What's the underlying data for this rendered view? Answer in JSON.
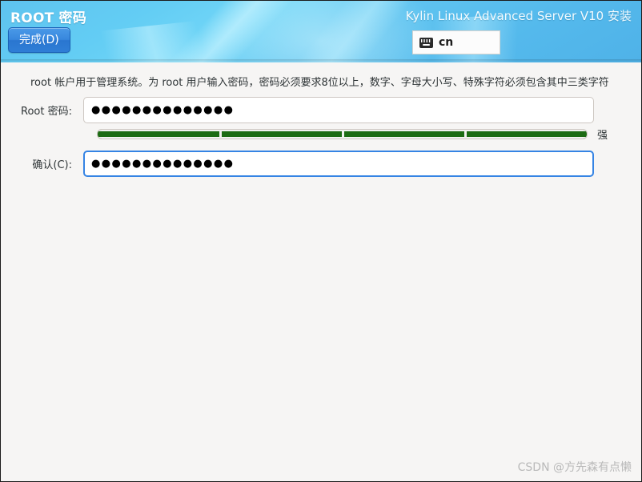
{
  "header": {
    "spoke_title": "ROOT 密码",
    "product_title": "Kylin Linux Advanced Server V10 安装",
    "done_button_label": "完成(D)",
    "keyboard_layout": "cn",
    "keyboard_icon": "keyboard-icon",
    "accent_color": "#3584e4",
    "header_gradient_top": "#5ec3ef",
    "header_gradient_bottom": "#4fb2e8"
  },
  "content": {
    "description": "root 帐户用于管理系统。为 root 用户输入密码，密码必须要求8位以上，数字、字母大小写、特殊字符必须包含其中三类字符",
    "fields": [
      {
        "name": "root-password",
        "label": "Root 密码:",
        "value": "●●●●●●●●●●●●●●",
        "placeholder": "",
        "focused": false
      },
      {
        "name": "confirm-password",
        "label": "确认(C):",
        "value": "●●●●●●●●●●●●●●",
        "placeholder": "",
        "focused": true
      }
    ],
    "strength": {
      "label": "强",
      "percent": 100,
      "segments": 4,
      "color": "#1c6b13"
    }
  },
  "watermark": "CSDN @方先森有点懒"
}
